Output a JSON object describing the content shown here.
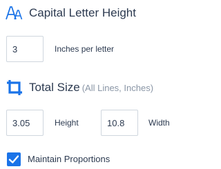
{
  "capital_letter_height": {
    "icon": "font-size-icon",
    "title": "Capital Letter Height",
    "value": "3",
    "unit_label": "Inches per letter"
  },
  "total_size": {
    "icon": "crop-icon",
    "title": "Total Size",
    "subtitle": "(All Lines, Inches)",
    "height_value": "3.05",
    "height_label": "Height",
    "width_value": "10.8",
    "width_label": "Width"
  },
  "maintain_proportions": {
    "checked": true,
    "label": "Maintain Proportions"
  },
  "colors": {
    "accent": "#1a73e8",
    "text": "#2c3a50",
    "muted": "#8a96a6",
    "border": "#cfd6de"
  }
}
